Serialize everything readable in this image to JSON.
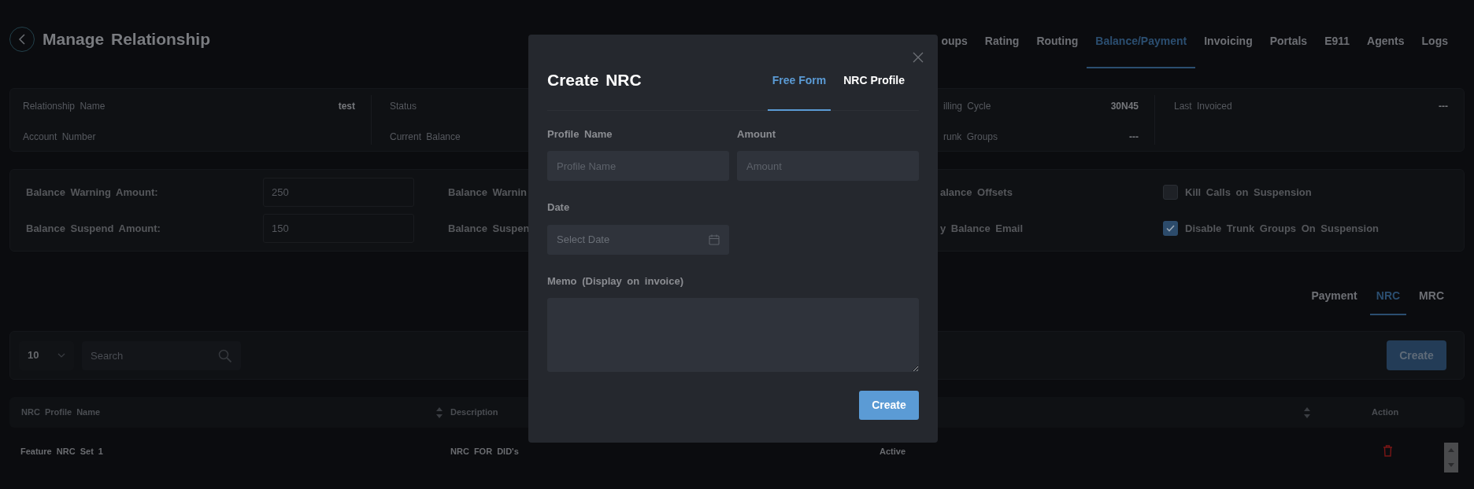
{
  "header": {
    "title": "Manage Relationship"
  },
  "nav_tabs": [
    {
      "label": "oups",
      "selected": false
    },
    {
      "label": "Rating",
      "selected": false
    },
    {
      "label": "Routing",
      "selected": false
    },
    {
      "label": "Balance/Payment",
      "selected": true
    },
    {
      "label": "Invoicing",
      "selected": false
    },
    {
      "label": "Portals",
      "selected": false
    },
    {
      "label": "E911",
      "selected": false
    },
    {
      "label": "Agents",
      "selected": false
    },
    {
      "label": "Logs",
      "selected": false
    }
  ],
  "info_card": {
    "columns": [
      {
        "items": [
          {
            "label": "Relationship Name",
            "value": "test"
          },
          {
            "label": "Account Number"
          }
        ]
      },
      {
        "items": [
          {
            "label": "Status"
          },
          {
            "label": "Current Balance"
          }
        ]
      },
      {
        "items": [
          {
            "label": "illing Cycle",
            "value": "30N45"
          },
          {
            "label": "runk Groups",
            "value": "---"
          }
        ]
      },
      {
        "items": [
          {
            "label": "Last Invoiced",
            "value": "---"
          }
        ]
      }
    ]
  },
  "settings": {
    "rows": [
      {
        "label": "Balance Warning Amount:",
        "placeholder": "250",
        "cut_label": "Balance Warnin",
        "option": "alance Offsets",
        "checkbox": {
          "label": "Kill Calls on Suspension",
          "checked": false
        }
      },
      {
        "label": "Balance Suspend Amount:",
        "placeholder": "150",
        "cut_label": "Balance Suspen",
        "option": "y Balance Email",
        "checkbox": {
          "label": "Disable Trunk Groups On Suspension",
          "checked": true
        }
      }
    ]
  },
  "sub_tabs": [
    {
      "label": "Payment",
      "selected": false
    },
    {
      "label": "NRC",
      "selected": true
    },
    {
      "label": "MRC",
      "selected": false
    }
  ],
  "toolbar": {
    "page_size": "10",
    "search": {
      "placeholder": "Search"
    },
    "create_button": "Create"
  },
  "table": {
    "columns": [
      {
        "label": "NRC Profile Name",
        "sortable": true
      },
      {
        "label": "Description",
        "sortable": false
      },
      {
        "sortable": true
      },
      {
        "label": "Action",
        "sortable": false
      }
    ],
    "rows": [
      {
        "cells": [
          "Feature NRC Set 1",
          "NRC FOR DID's",
          "Active"
        ]
      }
    ]
  },
  "modal": {
    "title": "Create NRC",
    "tabs": [
      {
        "label": "Free Form",
        "selected": true
      },
      {
        "label": "NRC Profile",
        "selected": false
      }
    ],
    "fields": [
      {
        "kind": "text",
        "label": "Profile Name",
        "placeholder": "Profile Name"
      },
      {
        "kind": "text",
        "label": "Amount",
        "placeholder": "Amount"
      },
      {
        "kind": "date",
        "label": "Date",
        "placeholder": "Select Date"
      },
      {
        "kind": "textarea",
        "label": "Memo (Display on invoice)"
      }
    ],
    "submit": "Create"
  }
}
